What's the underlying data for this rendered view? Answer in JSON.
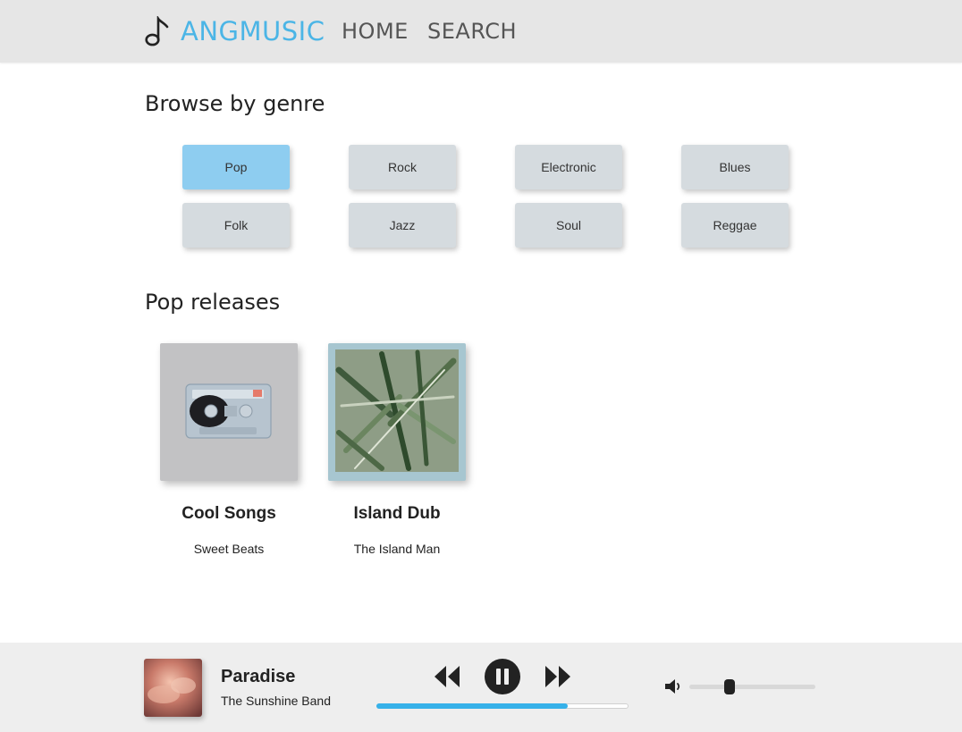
{
  "header": {
    "brand": "ANGMUSIC",
    "brand_icon": "music-note-icon",
    "brand_color": "#4bb5e6",
    "nav": [
      {
        "label": "HOME"
      },
      {
        "label": "SEARCH"
      }
    ]
  },
  "genres": {
    "title": "Browse by genre",
    "selected": "Pop",
    "active_color": "#8ecdf0",
    "items": [
      {
        "label": "Pop",
        "active": true
      },
      {
        "label": "Rock",
        "active": false
      },
      {
        "label": "Electronic",
        "active": false
      },
      {
        "label": "Blues",
        "active": false
      },
      {
        "label": "Folk",
        "active": false
      },
      {
        "label": "Jazz",
        "active": false
      },
      {
        "label": "Soul",
        "active": false
      },
      {
        "label": "Reggae",
        "active": false
      }
    ]
  },
  "releases": {
    "title": "Pop releases",
    "albums": [
      {
        "title": "Cool Songs",
        "artist": "Sweet Beats",
        "cover": "cassette-tape-image"
      },
      {
        "title": "Island Dub",
        "artist": "The Island Man",
        "cover": "palm-leaves-image"
      }
    ]
  },
  "player": {
    "title": "Paradise",
    "artist": "The Sunshine Band",
    "cover": "pink-clouds-image",
    "state": "playing",
    "progress": 0.76,
    "volume": 0.32,
    "accent": "#36b1e9",
    "icons": {
      "prev": "rewind-icon",
      "play": "pause-icon",
      "next": "fast-forward-icon",
      "volume": "volume-icon"
    }
  }
}
